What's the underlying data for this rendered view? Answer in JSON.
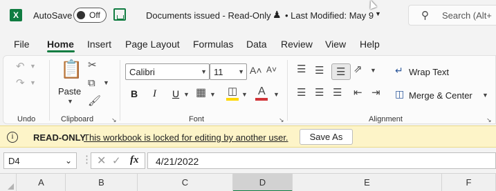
{
  "titlebar": {
    "autosave_label": "AutoSave",
    "autosave_state": "Off",
    "document_title": "Documents issued  -  Read-Only",
    "last_modified": "• Last Modified: May 9",
    "search_placeholder": "Search (Alt+"
  },
  "tabs": [
    "File",
    "Home",
    "Insert",
    "Page Layout",
    "Formulas",
    "Data",
    "Review",
    "View",
    "Help"
  ],
  "active_tab": "Home",
  "ribbon": {
    "undo_group": "Undo",
    "clipboard_group": "Clipboard",
    "paste_label": "Paste",
    "font_group": "Font",
    "font_name": "Calibri",
    "font_size": "11",
    "alignment_group": "Alignment",
    "wrap_text": "Wrap Text",
    "merge_center": "Merge & Center"
  },
  "readonly_bar": {
    "label": "READ-ONLY",
    "message": "This workbook is locked for editing by another user.",
    "button": "Save As"
  },
  "formula_bar": {
    "name_box": "D4",
    "fx": "fx",
    "value": "4/21/2022"
  },
  "columns": [
    "A",
    "B",
    "C",
    "D",
    "E",
    "F"
  ],
  "selected_column": "D",
  "colors": {
    "accent": "#107c41",
    "readonly_bg": "#fdf4c8",
    "fill_highlight": "#ffd800",
    "font_color": "#d13438"
  }
}
